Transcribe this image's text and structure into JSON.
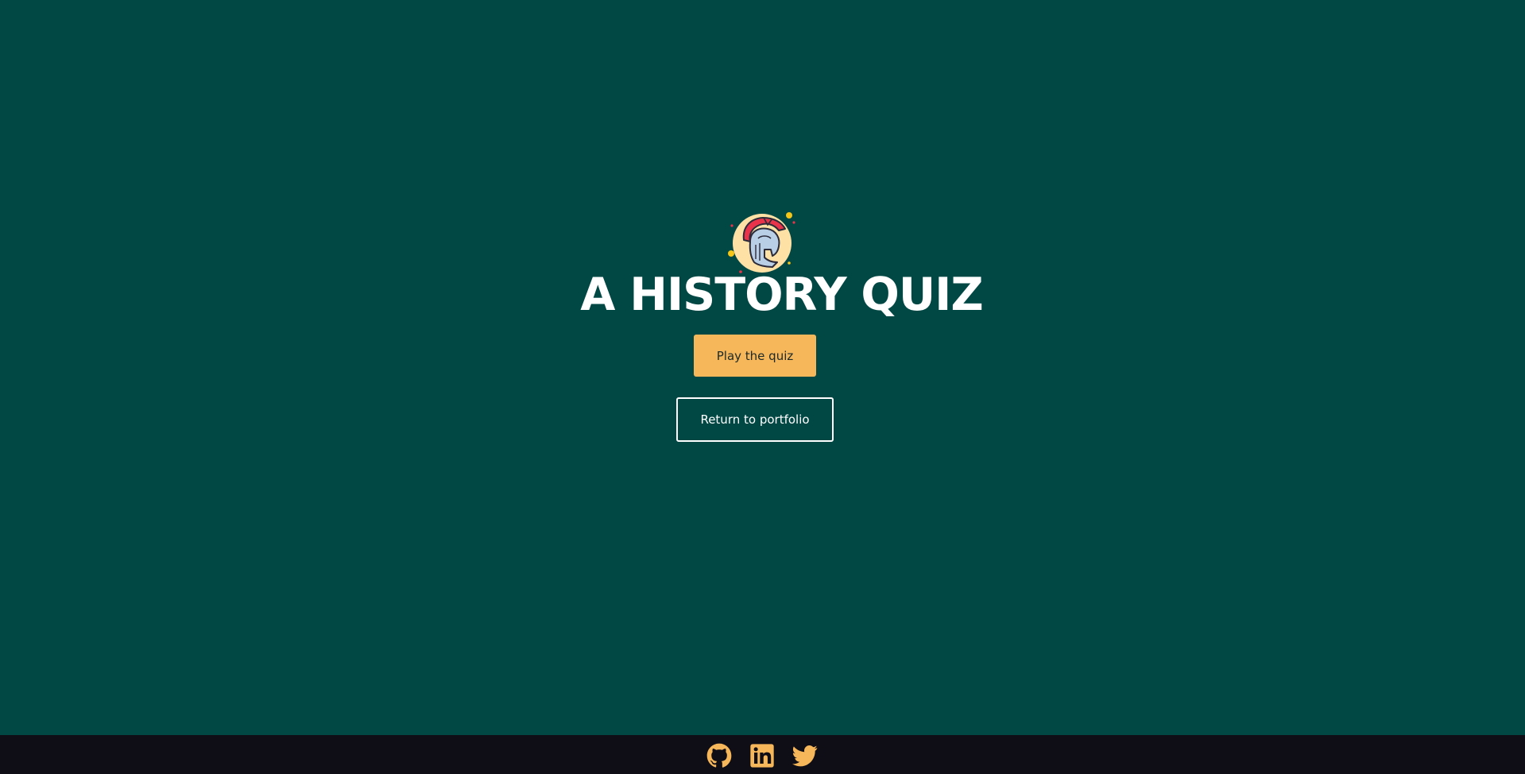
{
  "hero": {
    "logo_icon": "spartan-helmet-icon",
    "title": "A HISTORY QUIZ",
    "play_button_label": "Play the quiz",
    "return_button_label": "Return to portfolio"
  },
  "footer": {
    "social_links": [
      {
        "name": "github",
        "icon": "github-icon"
      },
      {
        "name": "linkedin",
        "icon": "linkedin-icon"
      },
      {
        "name": "twitter",
        "icon": "twitter-icon"
      }
    ]
  },
  "colors": {
    "background": "#014845",
    "accent": "#f6b65a",
    "footer_background": "#0f0e17",
    "text": "#ffffff"
  }
}
